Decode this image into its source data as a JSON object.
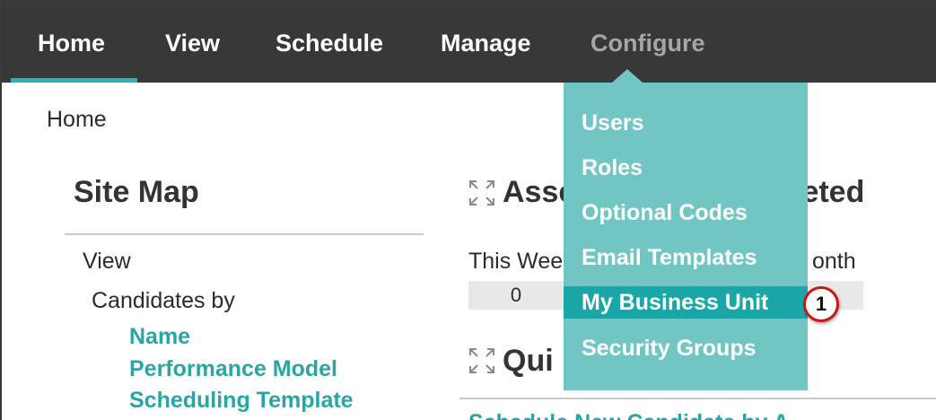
{
  "nav": {
    "items": [
      {
        "label": "Home"
      },
      {
        "label": "View"
      },
      {
        "label": "Schedule"
      },
      {
        "label": "Manage"
      },
      {
        "label": "Configure"
      }
    ],
    "active": "Home",
    "open_menu": "Configure"
  },
  "breadcrumb": "Home",
  "sitemap": {
    "title": "Site Map",
    "section": "View",
    "subsection": "Candidates by",
    "links": [
      "Name",
      "Performance Model",
      "Scheduling Template"
    ]
  },
  "widgets": {
    "assessments_title_start": "Asse",
    "assessments_title_end": "leted",
    "this_week_label": "This Wee",
    "month_label": "onth",
    "this_week_value": "0",
    "quick_title": "Qui",
    "cut_link": "Schedule New Candidate by A"
  },
  "configure_menu": {
    "items": [
      "Users",
      "Roles",
      "Optional Codes",
      "Email Templates",
      "My Business Unit",
      "Security Groups"
    ],
    "highlighted": "My Business Unit"
  },
  "callout": "1",
  "icons": {
    "expand": "expand-arrows-icon"
  },
  "colors": {
    "nav_bg": "#383838",
    "accent": "#2cb3b3",
    "menu_bg": "#71c6c3",
    "menu_highlight": "#1aa6a7",
    "link": "#2aa4a4",
    "callout_border": "#c71818"
  }
}
